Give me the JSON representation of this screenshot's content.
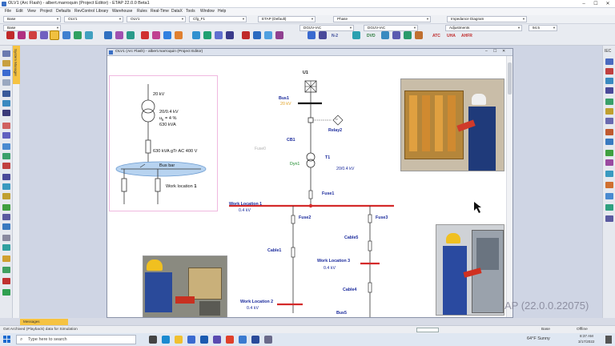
{
  "window": {
    "title": "OLV1 (Arc Flash) - albert.marroquin (Project Editor) - ETAP 22.0.0 Beta1",
    "minimize": "–",
    "maximize": "☐",
    "close": "✕"
  },
  "menu": [
    "File",
    "Edit",
    "View",
    "Project",
    "Defaults",
    "RevControl",
    "Library",
    "Warehouse",
    "Rules",
    "Real-Time",
    "DataX",
    "Tools",
    "Window",
    "Help"
  ],
  "combos": {
    "base": "Base",
    "olv1": "OLV1",
    "olv1b": "OLV1",
    "cfg": "Cfg_F1",
    "etap_default": "ETAP (Default)",
    "phase": "Phase",
    "impedance": "Impedance Diagram",
    "dguv_arc1": "DGUV-IAC",
    "dguv_arc2": "DGUV-IAC",
    "adjustments": "Adjustments",
    "zoom": "94.5"
  },
  "toolbar": {
    "n2": "N-2",
    "dvd": "DVD",
    "atc": "ATC",
    "uha": "UHA",
    "ahfr": "AHFR"
  },
  "dock": {
    "system_manager": "System Manager"
  },
  "right": {
    "iec": "IEC"
  },
  "editor": {
    "title": "OLV1 (Arc Flash) - albert.marroquin (Project Editor)"
  },
  "inset": {
    "voltage_top": "20 kV",
    "transformer_line1": "20/0.4 kV",
    "transformer_line2": "u",
    "transformer_line2_sub": "k",
    "transformer_line2_rest": " = 4 %",
    "transformer_line3": "630 kVA",
    "fuse_label": "630 kVA gTr AC 400 V",
    "busbar": "Bus bar",
    "work_location": "Work location",
    "work_location_num": "1"
  },
  "oneline": {
    "u1": "U1",
    "bus1": "Bus1",
    "bus1_kv": "20 kV",
    "relay2": "Relay2",
    "relay_symbol": "I>",
    "cb1": "CB1",
    "fuse0": "Fuse0",
    "t1": "T1",
    "dyn1": "Dyn1",
    "t1_rating": "20/0.4 kV",
    "fuse1": "Fuse1",
    "wl1": "Work Location 1",
    "wl1_kv": "0.4 kV",
    "fuse2": "Fuse2",
    "fuse3": "Fuse3",
    "cable5": "Cable5",
    "cable1": "Cable1",
    "wl3": "Work Location 3",
    "wl3_kv": "0.4 kV",
    "cable4": "Cable4",
    "wl2": "Work Location 2",
    "wl2_kv": "0.4 kV",
    "bus5": "Bus5"
  },
  "watermark": "AP (22.0.0.22075)",
  "messages_tab": "Messages",
  "status": {
    "left": "Get Archived (Playback) data for Simulation",
    "base": "Base",
    "offline": "Offline"
  },
  "taskbar": {
    "search_placeholder": "Type here to search",
    "weather": "64°F Sunny",
    "time": "8:37 AM",
    "date": "3/17/2022"
  }
}
